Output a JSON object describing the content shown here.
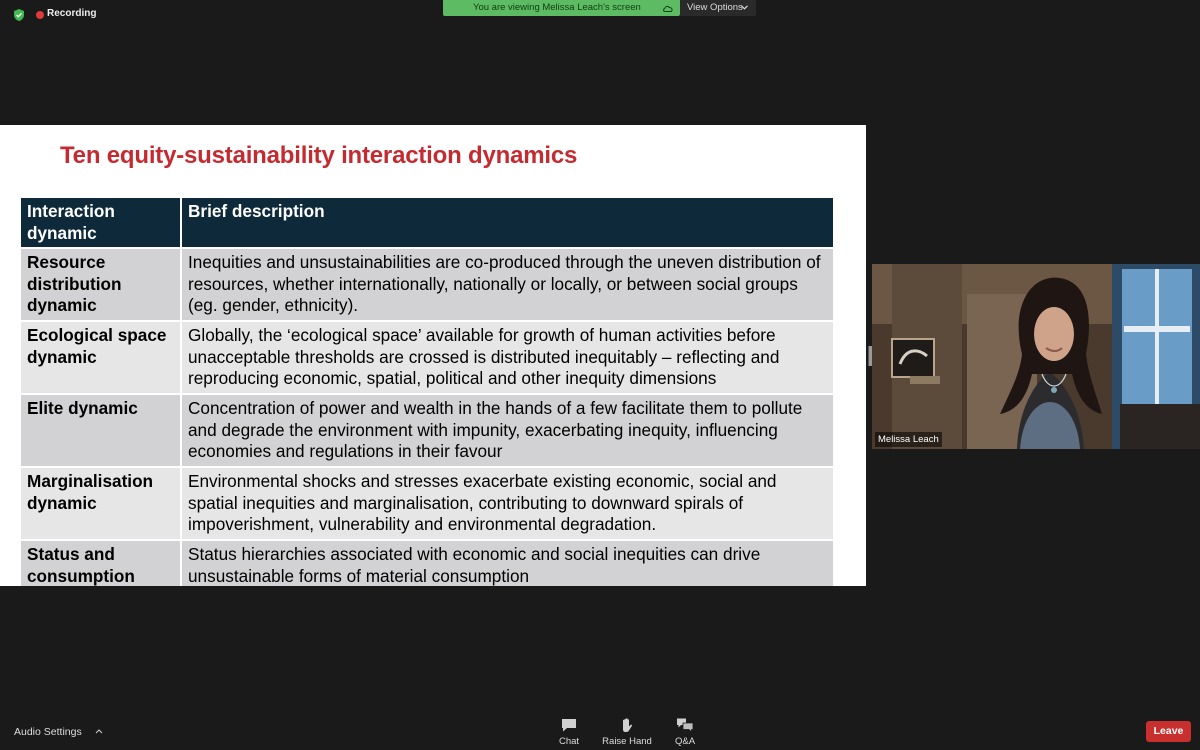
{
  "top_bar": {
    "recording_label": "Recording",
    "share_banner": "You are viewing Melissa Leach's screen",
    "view_options_label": "View Options",
    "icons": [
      "shield-icon",
      "record-dot-icon",
      "cloud-icon",
      "chevron-down-icon"
    ],
    "colors": {
      "banner": "#5dbb63",
      "record_dot": "#e0393e"
    }
  },
  "slide": {
    "title": "Ten equity-sustainability interaction dynamics",
    "colors": {
      "title": "#c42b31",
      "header_bg": "#0e2a3a"
    },
    "table": {
      "headers": [
        "Interaction dynamic",
        "Brief description"
      ],
      "rows": [
        {
          "name": "Resource distribution dynamic",
          "description": "Inequities and unsustainabilities are co-produced through the uneven distribution of resources, whether internationally, nationally or locally, or between social groups (eg. gender, ethnicity)."
        },
        {
          "name": "Ecological space dynamic",
          "description": "Globally, the ‘ecological space’ available for growth of human activities before unacceptable thresholds are crossed is distributed inequitably – reflecting and reproducing economic, spatial, political and other inequity dimensions"
        },
        {
          "name": "Elite dynamic",
          "description": "Concentration of power and wealth in the hands of a few facilitate them to pollute and degrade the environment with impunity, exacerbating inequity, influencing economies and regulations in their favour"
        },
        {
          "name": "Marginalisation dynamic",
          "description": "Environmental shocks and stresses exacerbate existing economic, social and spatial inequities and marginalisation, contributing to downward spirals of impoverishment, vulnerability and environmental degradation."
        },
        {
          "name": "Status and consumption dynamic",
          "description": "Status hierarchies associated with economic and social inequities can drive unsustainable forms of material consumption"
        }
      ]
    }
  },
  "video": {
    "participant_name": "Melissa Leach"
  },
  "toolbar": {
    "audio_settings_label": "Audio Settings",
    "chat_label": "Chat",
    "raise_hand_label": "Raise Hand",
    "qa_label": "Q&A",
    "leave_label": "Leave",
    "icons": [
      "chevron-up-icon",
      "chat-icon",
      "hand-icon",
      "qa-icon"
    ],
    "colors": {
      "leave": "#c8302f"
    }
  }
}
